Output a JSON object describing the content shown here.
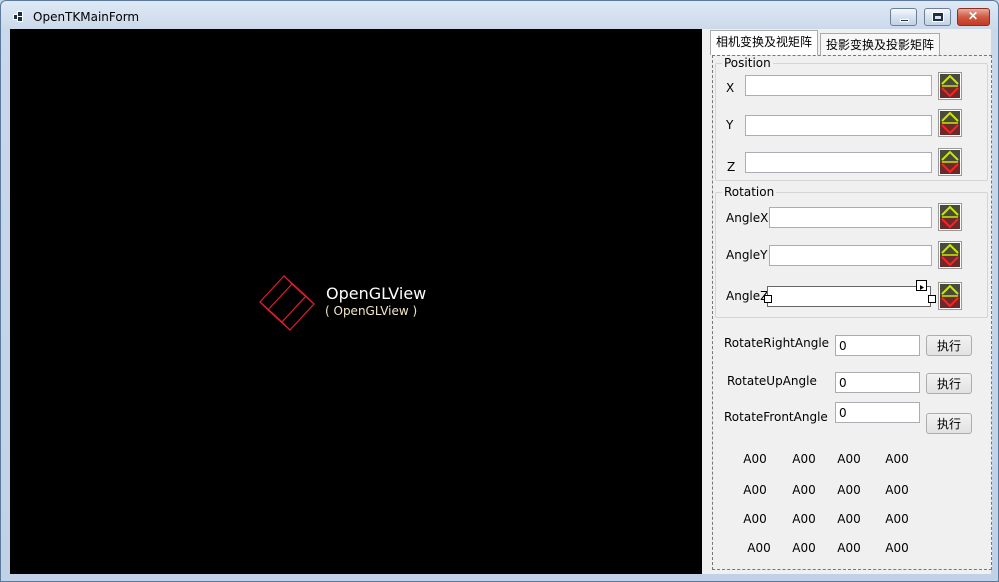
{
  "window": {
    "title": "OpenTKMainForm"
  },
  "gl_view": {
    "name": "OpenGLView",
    "type_label": "( OpenGLView )"
  },
  "tabs": [
    "相机变换及视矩阵",
    "投影变换及投影矩阵"
  ],
  "position_group": {
    "title": "Position",
    "labels": {
      "x": "X",
      "y": "Y",
      "z": "Z"
    },
    "values": {
      "x": "",
      "y": "",
      "z": ""
    }
  },
  "rotation_group": {
    "title": "Rotation",
    "labels": {
      "angle_x": "AngleX",
      "angle_y": "AngleY",
      "angle_z": "AngleZ"
    },
    "values": {
      "angle_x": "",
      "angle_y": "",
      "angle_z": ""
    }
  },
  "rotate_controls": {
    "right": {
      "label": "RotateRightAngle",
      "value": "0",
      "button": "执行"
    },
    "up": {
      "label": "RotateUpAngle",
      "value": "0",
      "button": "执行"
    },
    "front": {
      "label": "RotateFrontAngle",
      "value": "0",
      "button": "执行"
    }
  },
  "matrix": [
    [
      "A00",
      "A00",
      "A00",
      "A00"
    ],
    [
      "A00",
      "A00",
      "A00",
      "A00"
    ],
    [
      "A00",
      "A00",
      "A00",
      "A00"
    ],
    [
      "A00",
      "A00",
      "A00",
      "A00"
    ]
  ],
  "colors": {
    "gl_background": "#000000",
    "cube": "#d8202a",
    "icon_green": "#c8e800",
    "icon_red": "#ff2020"
  },
  "icons": {
    "app": "window-icon",
    "spin_button": "up-down-arrows-icon"
  }
}
